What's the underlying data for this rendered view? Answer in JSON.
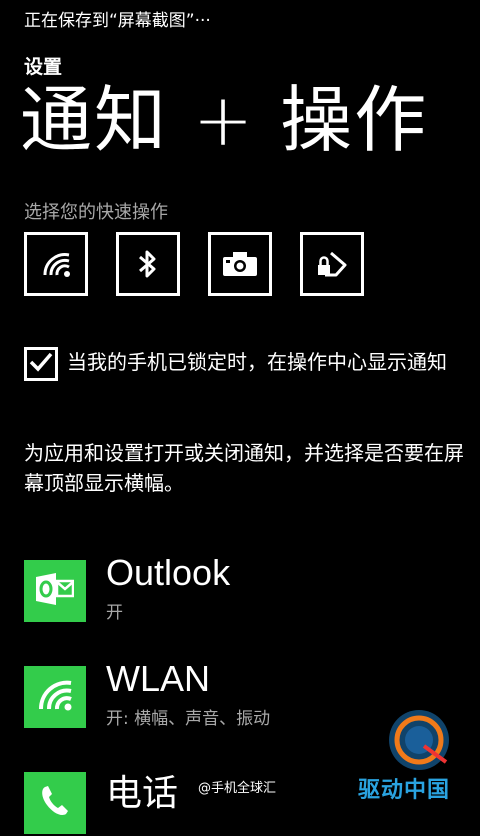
{
  "status_bar": {
    "text": "正在保存到“屏幕截图”···"
  },
  "header": {
    "section": "设置",
    "title": "通知 + 操作"
  },
  "quick_actions": {
    "label": "选择您的快速操作",
    "items": [
      {
        "icon": "wifi-icon"
      },
      {
        "icon": "bluetooth-icon"
      },
      {
        "icon": "camera-icon"
      },
      {
        "icon": "rotation-lock-icon"
      }
    ]
  },
  "lock_screen_option": {
    "checked": true,
    "label": "当我的手机已锁定时，在操作中心显示通知"
  },
  "description": "为应用和设置打开或关闭通知，并选择是否要在屏幕顶部显示横幅。",
  "apps": [
    {
      "name": "Outlook",
      "status": "开",
      "icon": "outlook-icon"
    },
    {
      "name": "WLAN",
      "status": "开: 横幅、声音、振动",
      "icon": "wifi-icon"
    },
    {
      "name": "电话",
      "status": "",
      "icon": "phone-icon"
    }
  ],
  "watermark": {
    "credit": "@手机全球汇",
    "brand": "驱动中国"
  },
  "colors": {
    "background": "#000000",
    "text": "#ffffff",
    "subtext": "#a8a8a8",
    "tile_accent": "#33cc4b",
    "brand": "#2aa3e0"
  }
}
